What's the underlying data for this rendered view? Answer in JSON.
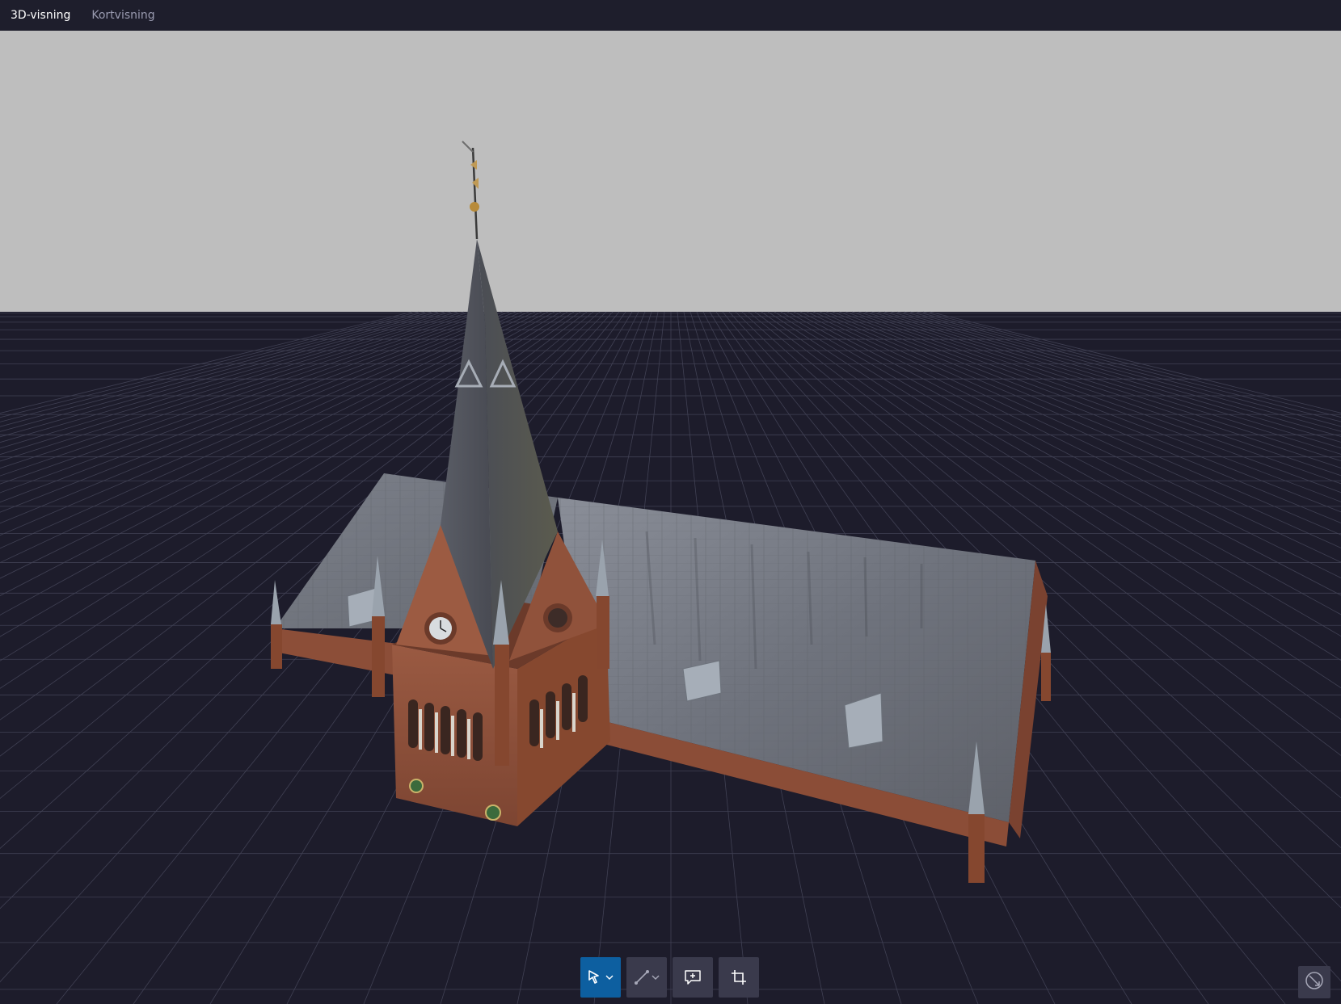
{
  "tabs": [
    {
      "label": "3D-visning",
      "active": true
    },
    {
      "label": "Kortvisning",
      "active": false
    }
  ],
  "colors": {
    "topbar": "#1e1e2c",
    "sky": "#bebebe",
    "ground": "#1d1c2b",
    "grid": "#5d5f75",
    "tool_active": "#0d5fa0",
    "tool_inactive": "#3a3a4c"
  },
  "toolbar": {
    "tools": [
      {
        "icon": "select-arrow-icon",
        "has_dropdown": true,
        "active": true
      },
      {
        "icon": "measure-line-icon",
        "has_dropdown": true,
        "active": false
      },
      {
        "icon": "add-comment-icon",
        "has_dropdown": false,
        "active": false
      },
      {
        "icon": "crop-icon",
        "has_dropdown": false,
        "active": false
      }
    ]
  },
  "compass": {
    "icon": "compass-icon"
  },
  "scene": {
    "model": "brick-church-with-spire-3d-model"
  }
}
